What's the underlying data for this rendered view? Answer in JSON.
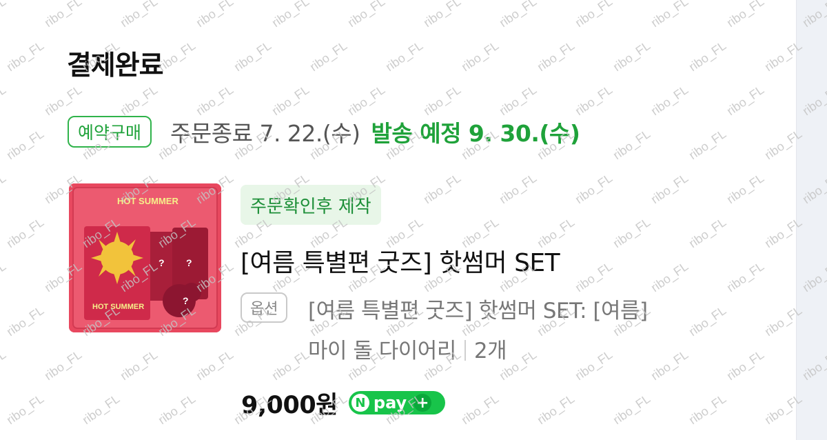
{
  "page": {
    "title": "결제완료"
  },
  "order": {
    "preorder_badge": "예약구매",
    "order_end": "주문종료 7. 22.(수)",
    "ship_date": "발송 예정 9. 30.(수)"
  },
  "item": {
    "made_badge": "주문확인후 제작",
    "name": "[여름 특별편 굿즈] 핫썸머 SET",
    "option_label": "옵션",
    "option_line1": "[여름 특별편 굿즈] 핫썸머 SET: [여름]",
    "option_line2": "마이 돌 다이어리",
    "quantity": "2개",
    "price": "9,000원",
    "image_text_top": "HOT SUMMER",
    "image_text_bottom": "HOT SUMMER"
  },
  "npay": {
    "n": "N",
    "label": "pay",
    "plus": "+"
  },
  "watermark_text": "ribo_FL",
  "colors": {
    "green": "#1fa23a",
    "pink": "#e8485f",
    "npay": "#18c44a"
  }
}
